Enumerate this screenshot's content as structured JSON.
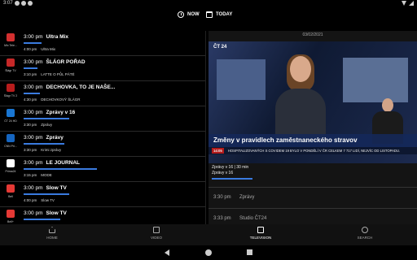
{
  "status": {
    "time": "3:07"
  },
  "top": {
    "now_label": "NOW",
    "today_label": "TODAY"
  },
  "accent": "#3a7be0",
  "programs": [
    {
      "channel": "Mix Tele...",
      "color": "#d32f2f",
      "time": "3:00 pm",
      "title": "Ultra Mix",
      "progress": 0.2,
      "next_time": "4:00 pm",
      "next_title": "Ultra Mix"
    },
    {
      "channel": "Šlágr TV",
      "color": "#c62828",
      "time": "3:00 pm",
      "title": "ŠLÁGR POŘAD",
      "progress": 0.15,
      "next_time": "3:10 pm",
      "next_title": "LATTE O PŮL PÁTÉ"
    },
    {
      "channel": "Šlágr TV 2",
      "color": "#b71c1c",
      "time": "3:00 pm",
      "title": "DECHOVKA, TO JE NAŠE...",
      "progress": 0.18,
      "next_time": "4:30 pm",
      "next_title": "DECHOVKOVÝ ŠLÁGR"
    },
    {
      "channel": "ČT 24 HD",
      "color": "#1976d2",
      "time": "3:00 pm",
      "title": "Zprávy v 16",
      "progress": 0.5,
      "next_time": "3:30 pm",
      "next_title": "Zprávy"
    },
    {
      "channel": "CNN Pri...",
      "color": "#1565c0",
      "time": "3:00 pm",
      "title": "Zprávy",
      "progress": 0.45,
      "next_time": "3:30 pm",
      "next_title": "Krimi zprávy"
    },
    {
      "channel": "Prima24",
      "color": "#ffffff",
      "time": "3:00 pm",
      "title": "LE JOURNAL",
      "progress": 0.8,
      "next_time": "3:15 pm",
      "next_title": "MODE"
    },
    {
      "channel": "Bell",
      "color": "#e53935",
      "time": "3:00 pm",
      "title": "Slow TV",
      "progress": 0.5,
      "next_time": "4:00 pm",
      "next_title": "Slow TV"
    },
    {
      "channel": "Bell+",
      "color": "#e53935",
      "time": "3:00 pm",
      "title": "Slow TV",
      "progress": 0.4,
      "next_time": "",
      "next_title": ""
    }
  ],
  "player": {
    "date": "03/02/2021",
    "channel": "ČT 24",
    "caption": "Změny v pravidlech zaměstnaneckého stravov",
    "ticker_time": "14:05",
    "ticker": "HOSPITALIZOVANÝCH S COVIDEM 19 BYLO V PONDĚLÍ V ČR CELKEM 7 717 LIDÍ, NEJVÍC OD LISTOPADU.",
    "info_line1": "Zprávy v 16 | 30 min",
    "info_line2": "Zprávy v 16"
  },
  "schedule": [
    {
      "time": "3:30 pm",
      "title": "Zprávy"
    },
    {
      "time": "3:33 pm",
      "title": "Studio ČT24"
    }
  ],
  "nav": [
    {
      "label": "HOME",
      "icon": "home-icon",
      "active": false
    },
    {
      "label": "VIDEO",
      "icon": "video-icon",
      "active": false
    },
    {
      "label": "TELEVISION",
      "icon": "tv-icon",
      "active": true
    },
    {
      "label": "SEARCH",
      "icon": "search-icon",
      "active": false
    }
  ]
}
